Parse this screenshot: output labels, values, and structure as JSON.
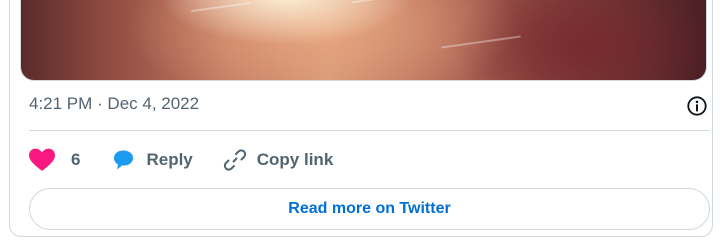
{
  "tweet": {
    "timestamp": "4:21 PM · Dec 4, 2022"
  },
  "actions": {
    "like_count": "6",
    "reply_label": "Reply",
    "copy_link_label": "Copy link"
  },
  "footer": {
    "read_more_label": "Read more on Twitter"
  },
  "icons": {
    "like": "heart-icon",
    "reply": "speech-bubble-icon",
    "copy_link": "link-icon",
    "info": "info-icon"
  },
  "colors": {
    "like": "#f91880",
    "reply": "#1d9bf0",
    "link_text": "#006fd6",
    "muted_text": "#536471",
    "border": "#cfd9de"
  }
}
